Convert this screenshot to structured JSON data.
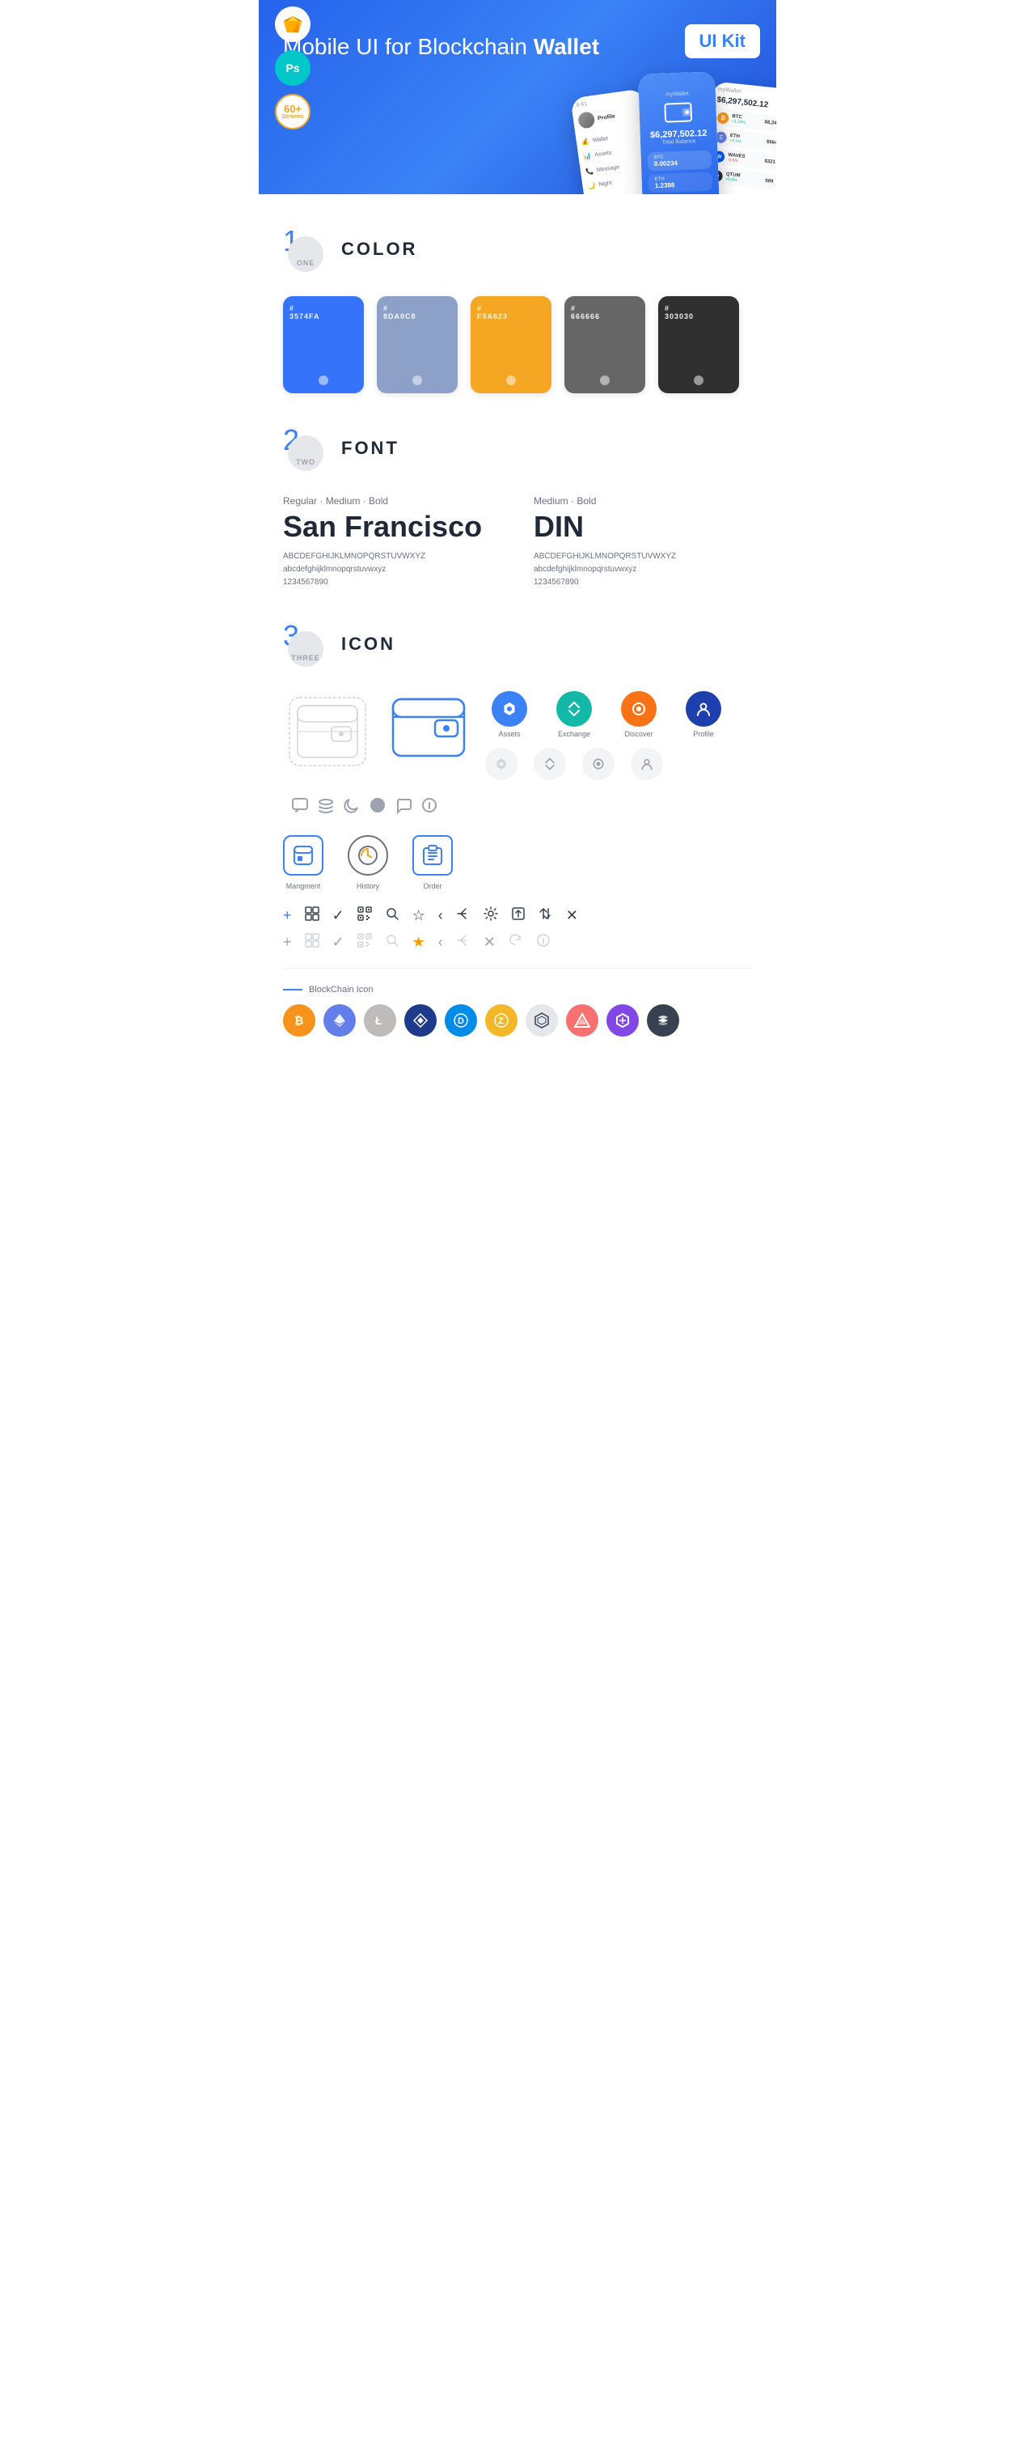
{
  "hero": {
    "title_normal": "Mobile UI for Blockchain ",
    "title_bold": "Wallet",
    "badge": "UI Kit",
    "badges": [
      {
        "type": "sketch",
        "label": "Sketch"
      },
      {
        "type": "ps",
        "label": "Ps"
      },
      {
        "type": "screens",
        "count": "60+",
        "sublabel": "Screens"
      }
    ]
  },
  "section1": {
    "number": "1",
    "word": "ONE",
    "title": "COLOR",
    "swatches": [
      {
        "hex": "#3574FA",
        "code": "#3574FA"
      },
      {
        "hex": "#8DA0C8",
        "code": "#8DA0C8"
      },
      {
        "hex": "#F5A623",
        "code": "#F5A623"
      },
      {
        "hex": "#666666",
        "code": "#666666"
      },
      {
        "hex": "#303030",
        "code": "#303030"
      }
    ]
  },
  "section2": {
    "number": "2",
    "word": "TWO",
    "title": "FONT",
    "fonts": [
      {
        "style": "Regular · Medium · Bold",
        "name": "San Francisco",
        "upper": "ABCDEFGHIJKLMNOPQRSTUVWXYZ",
        "lower": "abcdefghijklmnopqrstuvwxyz",
        "nums": "1234567890"
      },
      {
        "style": "Medium · Bold",
        "name": "DIN",
        "upper": "ABCDEFGHIJKLMNOPQRSTUVWXYZ",
        "lower": "abcdefghijklmnopqrstuvwxyz",
        "nums": "1234567890"
      }
    ]
  },
  "section3": {
    "number": "3",
    "word": "THREE",
    "title": "ICON",
    "nav_icons": [
      {
        "label": "Assets",
        "color": "blue"
      },
      {
        "label": "Exchange",
        "color": "teal"
      },
      {
        "label": "Discover",
        "color": "orange"
      },
      {
        "label": "Profile",
        "color": "dark-blue"
      }
    ],
    "app_icons": [
      {
        "label": "Mangment"
      },
      {
        "label": "History"
      },
      {
        "label": "Order"
      }
    ],
    "small_icons_row1": [
      "+",
      "⊞",
      "✓",
      "⊠",
      "🔍",
      "☆",
      "‹",
      "≪",
      "⚙",
      "↗",
      "⇄",
      "✕"
    ],
    "small_icons_row2": [
      "+",
      "⊞",
      "✓",
      "⊠",
      "⊙",
      "☆",
      "‹",
      "≪",
      "✕",
      "↻",
      "ℹ"
    ],
    "blockchain_label": "BlockChain Icon",
    "crypto_icons": [
      {
        "symbol": "₿",
        "label": "BTC",
        "class": "crypto-btc"
      },
      {
        "symbol": "Ξ",
        "label": "ETH",
        "class": "crypto-eth"
      },
      {
        "symbol": "Ł",
        "label": "LTC",
        "class": "crypto-ltc"
      },
      {
        "symbol": "◈",
        "label": "WAVES",
        "class": "crypto-waves"
      },
      {
        "symbol": "D",
        "label": "DASH",
        "class": "crypto-dash"
      },
      {
        "symbol": "Z",
        "label": "ZEC",
        "class": "crypto-zcash"
      },
      {
        "symbol": "✦",
        "label": "IOTA",
        "class": "crypto-iota"
      },
      {
        "symbol": "▲",
        "label": "ARK",
        "class": "crypto-ark"
      },
      {
        "symbol": "M",
        "label": "MATIC",
        "class": "crypto-matic"
      },
      {
        "symbol": "~",
        "label": "STR",
        "class": "crypto-stratis"
      }
    ]
  }
}
